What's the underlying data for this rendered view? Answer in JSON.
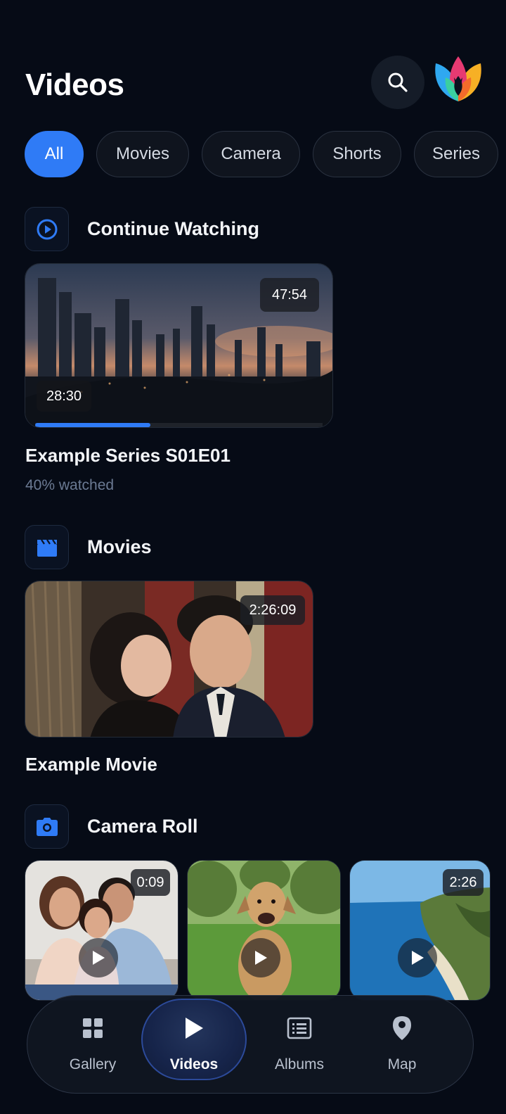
{
  "header": {
    "title": "Videos"
  },
  "filters": [
    {
      "label": "All",
      "active": true
    },
    {
      "label": "Movies",
      "active": false
    },
    {
      "label": "Camera",
      "active": false
    },
    {
      "label": "Shorts",
      "active": false
    },
    {
      "label": "Series",
      "active": false
    }
  ],
  "continue_watching": {
    "section_title": "Continue Watching",
    "item": {
      "duration": "47:54",
      "position": "28:30",
      "title": "Example Series S01E01",
      "progress_text": "40% watched",
      "progress": 0.4
    }
  },
  "movies": {
    "section_title": "Movies",
    "item": {
      "duration": "2:26:09",
      "title": "Example Movie"
    }
  },
  "camera_roll": {
    "section_title": "Camera Roll",
    "items": [
      {
        "duration": "0:09"
      },
      {
        "duration": ""
      },
      {
        "duration": "2:26"
      }
    ]
  },
  "bottom_nav": [
    {
      "label": "Gallery",
      "icon": "grid-icon",
      "active": false
    },
    {
      "label": "Videos",
      "icon": "play-icon",
      "active": true
    },
    {
      "label": "Albums",
      "icon": "list-icon",
      "active": false
    },
    {
      "label": "Map",
      "icon": "map-pin-icon",
      "active": false
    }
  ],
  "colors": {
    "background": "#060b16",
    "accent": "#2f7bf6",
    "muted_text": "#6b7a93"
  }
}
